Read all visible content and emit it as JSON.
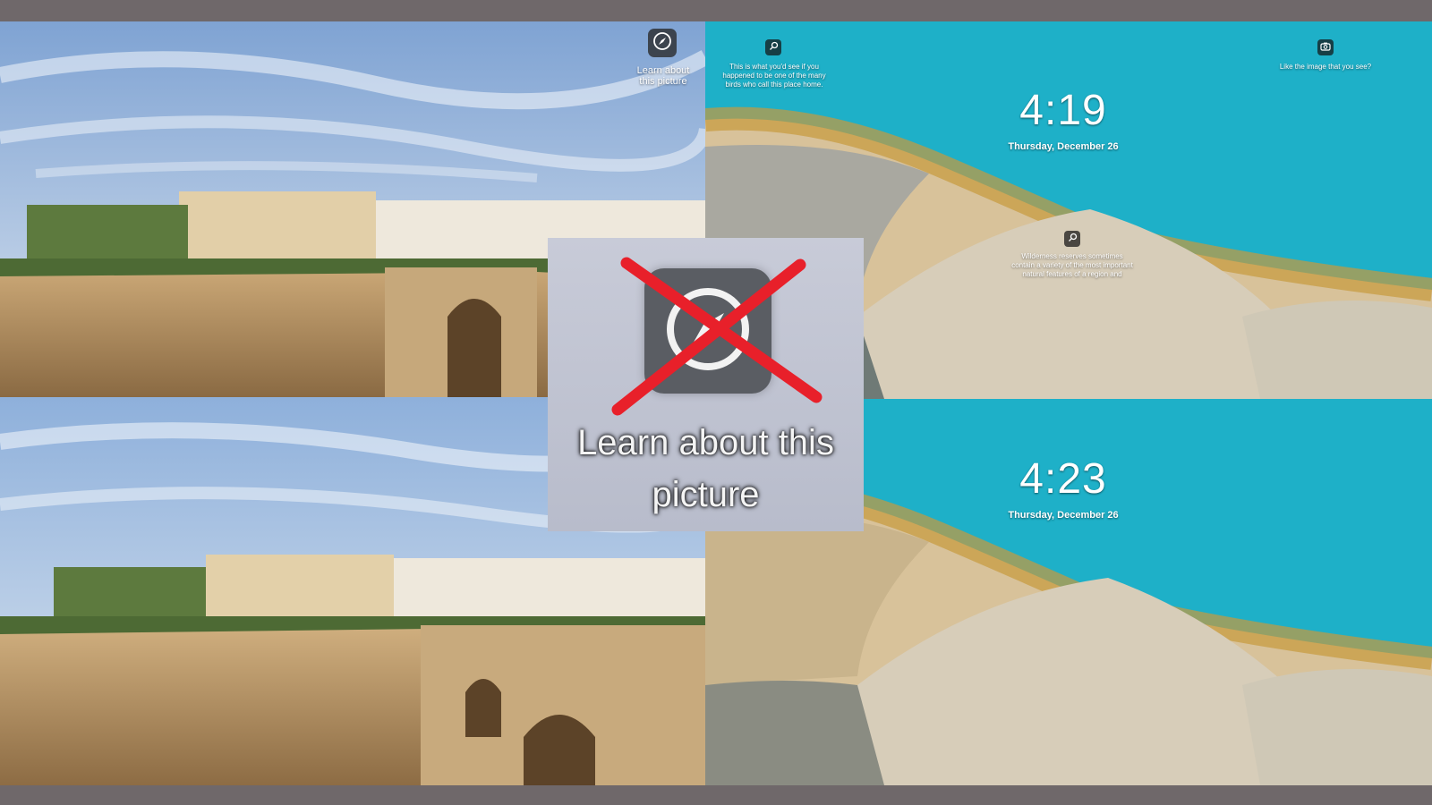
{
  "top_left": {
    "learn_button": {
      "icon": "compass-icon",
      "label": "Learn about this picture"
    }
  },
  "top_right": {
    "info_left": {
      "icon": "search-icon",
      "text": "This is what you'd see if you happened to be one of the many birds who call this place home."
    },
    "info_right": {
      "icon": "camera-icon",
      "text": "Like the image that you see?"
    },
    "clock": {
      "time": "4:19",
      "date": "Thursday, December 26"
    },
    "info_center": {
      "icon": "search-icon",
      "text": "Wilderness reserves sometimes contain a variety of the most important natural features of a region and"
    }
  },
  "bottom_right": {
    "clock": {
      "time": "4:23",
      "date": "Thursday, December 26"
    }
  },
  "zoom_inset": {
    "icon": "compass-icon",
    "label": "Learn about this picture",
    "overlay": "red-x-mark",
    "overlay_color": "#e8202a"
  },
  "colors": {
    "frame": "#6f686a",
    "sky": "#a9c4e2",
    "sea": "#1eb0c8",
    "sand": "#d8c29a"
  }
}
